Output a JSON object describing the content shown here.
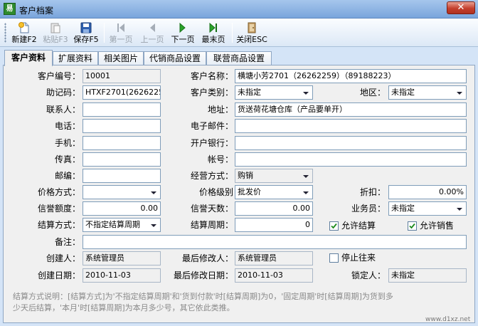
{
  "window": {
    "title": "客户档案",
    "app_icon": "易",
    "close": "✕"
  },
  "toolbar": {
    "new": "新建F2",
    "paste": "粘贴F3",
    "save": "保存F5",
    "first": "第一页",
    "prev": "上一页",
    "next": "下一页",
    "last": "最末页",
    "close": "关闭ESC"
  },
  "tabs": [
    "客户资料",
    "扩展资料",
    "相关图片",
    "代销商品设置",
    "联营商品设置"
  ],
  "form": {
    "code_label": "客户编号：",
    "code": "10001",
    "name_label": "客户名称：",
    "name": "横塘小芳2701（26262259）（89188223）",
    "mnemonic_label": "助记码：",
    "mnemonic": "HTXF2701(26262259)",
    "category_label": "客户类别：",
    "category": "未指定",
    "region_label": "地区：",
    "region": "未指定",
    "contact_label": "联系人：",
    "contact": "",
    "address_label": "地址：",
    "address": "货送荷花塘仓库（产品要单开）",
    "phone_label": "电话：",
    "phone": "",
    "email_label": "电子邮件：",
    "email": "",
    "mobile_label": "手机：",
    "mobile": "",
    "bank_label": "开户银行：",
    "bank": "",
    "fax_label": "传真：",
    "fax": "",
    "account_label": "帐号：",
    "account": "",
    "zip_label": "邮编：",
    "zip": "",
    "biz_mode_label": "经营方式：",
    "biz_mode": "购销",
    "price_mode_label": "价格方式：",
    "price_mode": "",
    "price_level_label": "价格级别",
    "price_level": "批发价",
    "discount_label": "折扣：",
    "discount": "0.00%",
    "credit_label": "信誉额度：",
    "credit": "0.00",
    "credit_days_label": "信誉天数：",
    "credit_days": "0.00",
    "salesman_label": "业务员：",
    "salesman": "未指定",
    "settle_mode_label": "结算方式：",
    "settle_mode": "不指定结算周期",
    "settle_period_label": "结算周期：",
    "settle_period": "0",
    "allow_settle_label": "允许结算",
    "allow_settle": true,
    "allow_sale_label": "允许销售",
    "allow_sale": true,
    "remark_label": "备注：",
    "remark": "",
    "creator_label": "创建人：",
    "creator": "系统管理员",
    "modifier_label": "最后修改人：",
    "modifier": "系统管理员",
    "stop_label": "停止往来",
    "stop": false,
    "created_label": "创建日期：",
    "created": "2010-11-03",
    "modified_label": "最后修改日期：",
    "modified": "2010-11-03",
    "locker_label": "锁定人：",
    "locker": "未指定"
  },
  "note": {
    "line1": "结算方式说明：[结算方式]为'不指定结算周期'和'货到付款'时[结算周期]为0，'固定周期'时[结算周期]为货到多",
    "line2": "少天后结算，'本月'时[结算周期]为本月多少号，其它依此类推。"
  },
  "watermark": "www.d1xz.net",
  "colors": {
    "titlebar": "#a6c6ec",
    "close_button": "#c4402d",
    "panel": "#f0f0f0",
    "window_bg": "#d4e4f7"
  },
  "icons": {
    "new": "new-file-icon",
    "paste": "paste-icon",
    "save": "floppy-save-icon",
    "first": "first-page-icon",
    "prev": "prev-page-icon",
    "next": "next-page-icon",
    "last": "last-page-icon",
    "close": "exit-door-icon",
    "dropdown": "chevron-down-icon",
    "check": "checkmark-icon"
  }
}
